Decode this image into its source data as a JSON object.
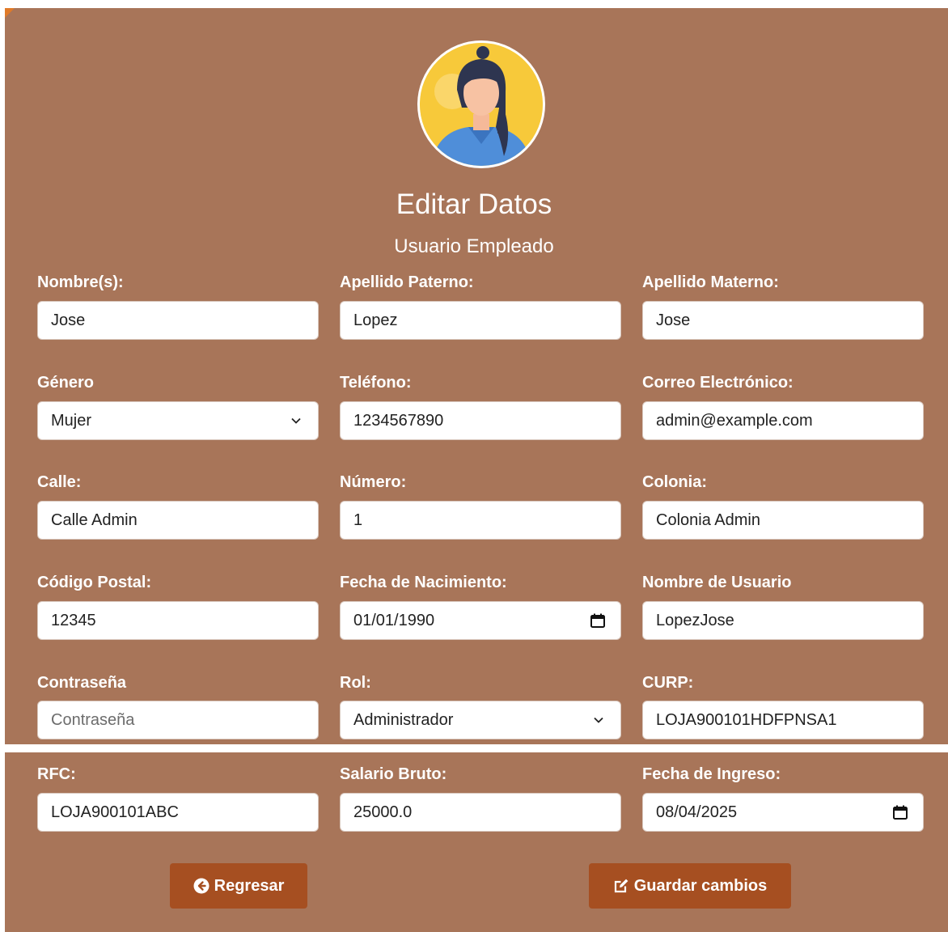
{
  "header": {
    "title": "Editar Datos",
    "subtitle": "Usuario Empleado",
    "avatar_icon": "user-avatar-icon"
  },
  "form": {
    "nombre": {
      "label": "Nombre(s):",
      "value": "Jose"
    },
    "apellido_pat": {
      "label": "Apellido Paterno:",
      "value": "Lopez"
    },
    "apellido_mat": {
      "label": "Apellido Materno:",
      "value": "Jose"
    },
    "genero": {
      "label": "Género",
      "value": "Mujer"
    },
    "telefono": {
      "label": "Teléfono:",
      "value": "1234567890"
    },
    "correo": {
      "label": "Correo Electrónico:",
      "value": "admin@example.com"
    },
    "calle": {
      "label": "Calle:",
      "value": "Calle Admin"
    },
    "numero": {
      "label": "Número:",
      "value": "1"
    },
    "colonia": {
      "label": "Colonia:",
      "value": "Colonia Admin"
    },
    "cp": {
      "label": "Código Postal:",
      "value": "12345"
    },
    "fecha_nac": {
      "label": "Fecha de Nacimiento:",
      "value": "01/01/1990"
    },
    "usuario": {
      "label": "Nombre de Usuario",
      "value": "LopezJose"
    },
    "contrasena": {
      "label": "Contraseña",
      "placeholder": "Contraseña"
    },
    "rol": {
      "label": "Rol:",
      "value": "Administrador"
    },
    "curp": {
      "label": "CURP:",
      "value": "LOJA900101HDFPNSA1"
    },
    "rfc": {
      "label": "RFC:",
      "value": "LOJA900101ABC"
    },
    "salario": {
      "label": "Salario Bruto:",
      "value": "25000.0"
    },
    "fecha_ingreso": {
      "label": "Fecha de Ingreso:",
      "value": "08/04/2025"
    }
  },
  "buttons": {
    "back": {
      "label": "Regresar",
      "icon": "arrow-left-circle-icon"
    },
    "save": {
      "label": "Guardar cambios",
      "icon": "edit-icon"
    }
  },
  "colors": {
    "panel": "#a87559",
    "button": "#a64f21",
    "text_light": "#ffffff"
  }
}
